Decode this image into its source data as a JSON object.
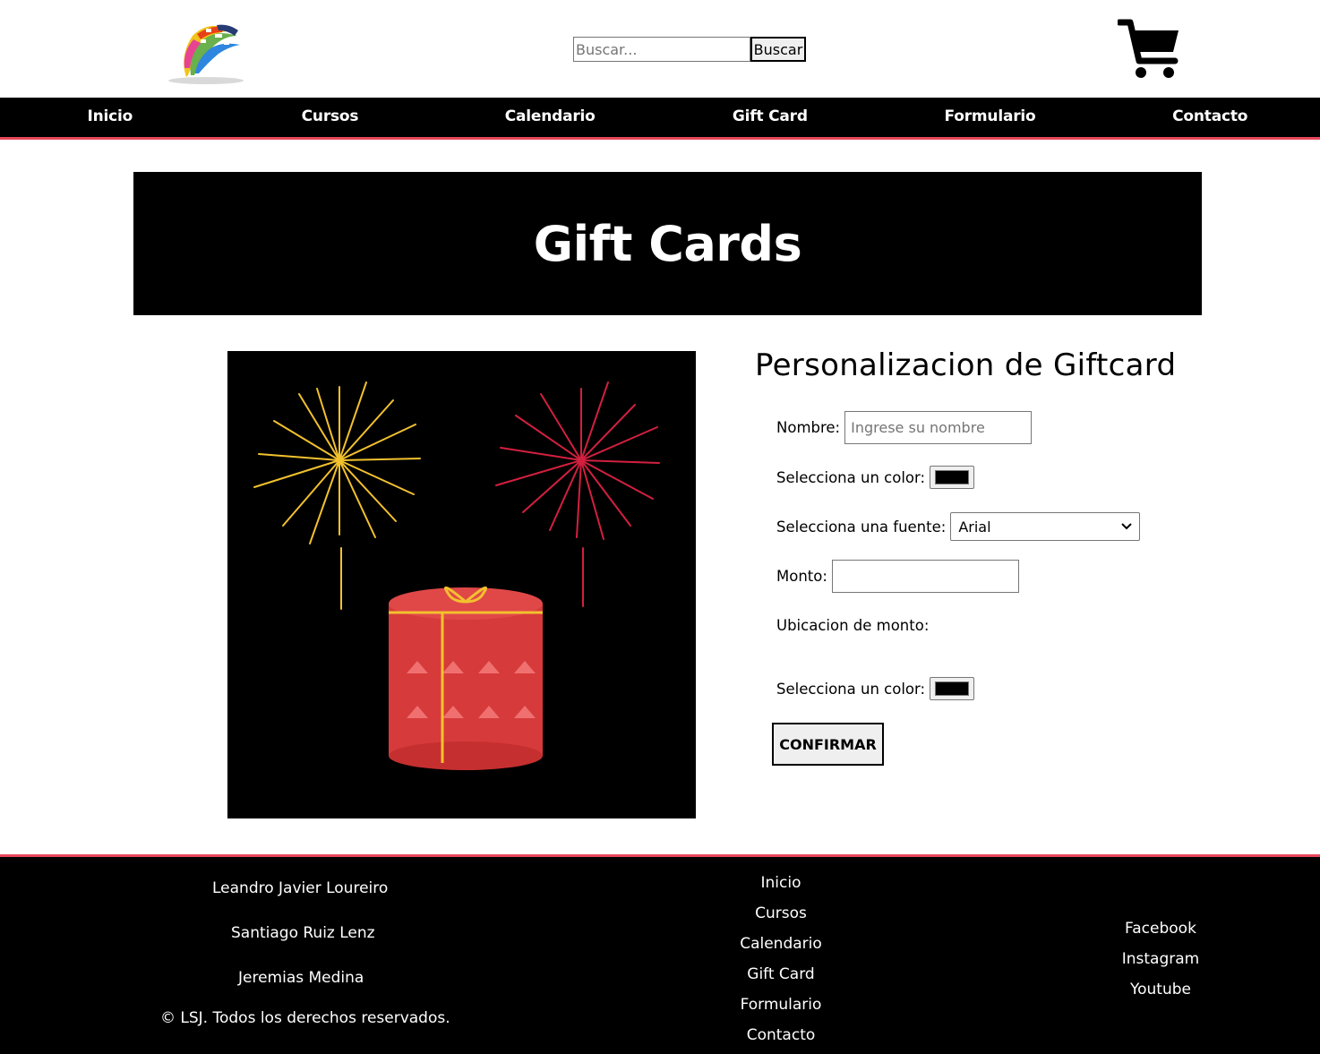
{
  "header": {
    "search_placeholder": "Buscar...",
    "search_button": "Buscar"
  },
  "nav": {
    "items": [
      "Inicio",
      "Cursos",
      "Calendario",
      "Gift Card",
      "Formulario",
      "Contacto"
    ]
  },
  "banner": {
    "title": "Gift Cards"
  },
  "form": {
    "title": "Personalizacion de Giftcard",
    "name_label": "Nombre:",
    "name_placeholder": "Ingrese su nombre",
    "color_label": "Selecciona un color:",
    "color_value": "#000000",
    "font_label": "Selecciona una fuente:",
    "font_value": "Arial",
    "amount_label": "Monto:",
    "amount_value": "",
    "amount_position_label": "Ubicacion de monto:",
    "color2_label": "Selecciona un color:",
    "color2_value": "#000000",
    "confirm_button": "CONFIRMAR"
  },
  "footer": {
    "authors": [
      "Leandro Javier Loureiro",
      "Santiago Ruiz Lenz",
      "Jeremias Medina"
    ],
    "copyright": "© LSJ. Todos los derechos reservados.",
    "links": [
      "Inicio",
      "Cursos",
      "Calendario",
      "Gift Card",
      "Formulario",
      "Contacto"
    ],
    "social": [
      "Facebook",
      "Instagram",
      "Youtube"
    ]
  },
  "colors": {
    "accent": "#e8475a",
    "nav_bg": "#000000",
    "footer_bg": "#000000"
  },
  "icons": {
    "logo": "globe-logo-icon",
    "cart": "shopping-cart-icon",
    "select_arrow": "chevron-down-icon"
  }
}
